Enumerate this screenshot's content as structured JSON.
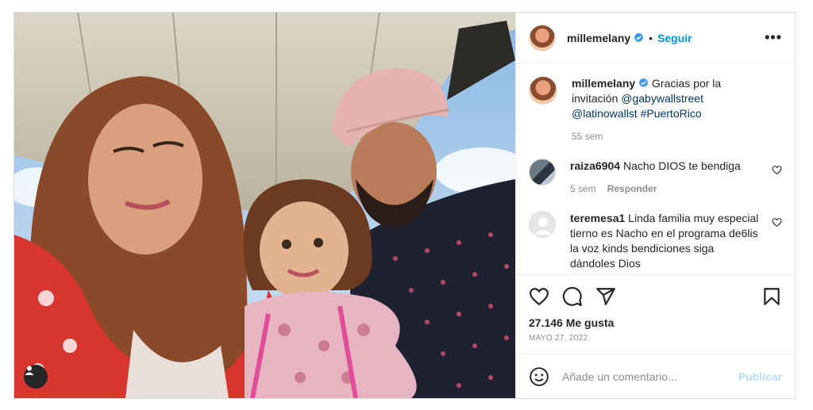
{
  "post": {
    "username": "millemelany",
    "follow_label": "Seguir",
    "separator": "•",
    "more_label": "•••",
    "caption": {
      "username": "millemelany",
      "text": "Gracias por la invitación",
      "mention1": "@gabywallstreet",
      "mention2": "@latinowallst",
      "hashtag": "#PuertoRico",
      "time": "55 sem"
    },
    "comments": [
      {
        "username": "raiza6904",
        "text": "Nacho DIOS te bendiga",
        "time": "5 sem",
        "reply": "Responder"
      },
      {
        "username": "teremesa1",
        "text": "Linda familia muy especial tierno es Nacho en el programa de6lis la voz kinds bendiciones siga dándoles Dios"
      }
    ],
    "likes": "27.146 Me gusta",
    "date": "MAYO 27, 2022",
    "comment_placeholder": "Añade un comentario...",
    "publish_label": "Publicar",
    "icons": {
      "like": "heart-icon",
      "comment": "comment-icon",
      "share": "send-icon",
      "save": "bookmark-icon",
      "emoji": "emoji-icon",
      "tag": "user-tag-icon",
      "verified": "verified-badge-icon"
    },
    "colors": {
      "link": "#00376b",
      "follow": "#0095f6",
      "publish_disabled": "#b2dffc",
      "verified": "#3897f0"
    }
  }
}
